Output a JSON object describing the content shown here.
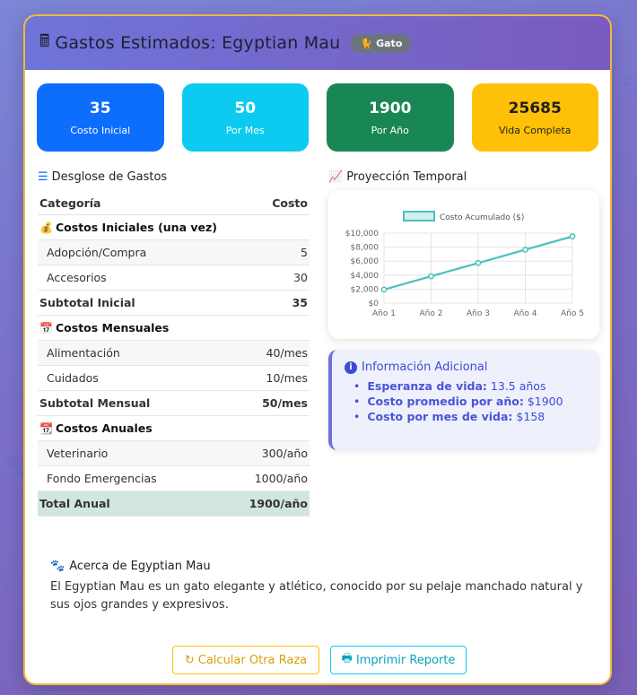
{
  "header": {
    "title": "Gastos Estimados: Egyptian Mau",
    "badge": "Gato"
  },
  "stats": [
    {
      "value": "35",
      "label": "Costo Inicial",
      "color": "#0d6efd"
    },
    {
      "value": "50",
      "label": "Por Mes",
      "color": "#0dcaf0"
    },
    {
      "value": "1900",
      "label": "Por Año",
      "color": "#198754"
    },
    {
      "value": "25685",
      "label": "Vida Completa",
      "color": "#ffc107"
    }
  ],
  "breakdown": {
    "title": "Desglose de Gastos",
    "col_category": "Categoría",
    "col_cost": "Costo",
    "initial_header": "Costos Iniciales (una vez)",
    "initial_items": [
      {
        "name": "Adopción/Compra",
        "cost": "5"
      },
      {
        "name": "Accesorios",
        "cost": "30"
      }
    ],
    "initial_subtotal_label": "Subtotal Inicial",
    "initial_subtotal": "35",
    "monthly_header": "Costos Mensuales",
    "monthly_items": [
      {
        "name": "Alimentación",
        "cost": "40/mes"
      },
      {
        "name": "Cuidados",
        "cost": "10/mes"
      }
    ],
    "monthly_subtotal_label": "Subtotal Mensual",
    "monthly_subtotal": "50/mes",
    "annual_header": "Costos Anuales",
    "annual_items": [
      {
        "name": "Veterinario",
        "cost": "300/año"
      },
      {
        "name": "Fondo Emergencias",
        "cost": "1000/año"
      }
    ],
    "annual_total_label": "Total Anual",
    "annual_total": "1900/año"
  },
  "projection": {
    "title": "Proyección Temporal"
  },
  "chart_data": {
    "type": "line",
    "categories": [
      "Año 1",
      "Año 2",
      "Año 3",
      "Año 4",
      "Año 5"
    ],
    "series": [
      {
        "name": "Costo Acumulado ($)",
        "values": [
          1935,
          3835,
          5735,
          7635,
          9535
        ]
      }
    ],
    "ylim": [
      0,
      10000
    ],
    "yticks": [
      "$10,000",
      "$8,000",
      "$6,000",
      "$4,000",
      "$2,000",
      "$0"
    ],
    "legend": "top",
    "grid": true,
    "line_color": "#4bc0c0"
  },
  "info": {
    "title": "Información Adicional",
    "items": [
      {
        "label": "Esperanza de vida:",
        "value": "13.5 años"
      },
      {
        "label": "Costo promedio por año:",
        "value": "$1900"
      },
      {
        "label": "Costo por mes de vida:",
        "value": "$158"
      }
    ]
  },
  "about": {
    "title": "Acerca de Egyptian Mau",
    "text": "El Egyptian Mau es un gato elegante y atlético, conocido por su pelaje manchado natural y sus ojos grandes y expresivos."
  },
  "buttons": {
    "recalc": "Calcular Otra Raza",
    "print": "Imprimir Reporte"
  }
}
